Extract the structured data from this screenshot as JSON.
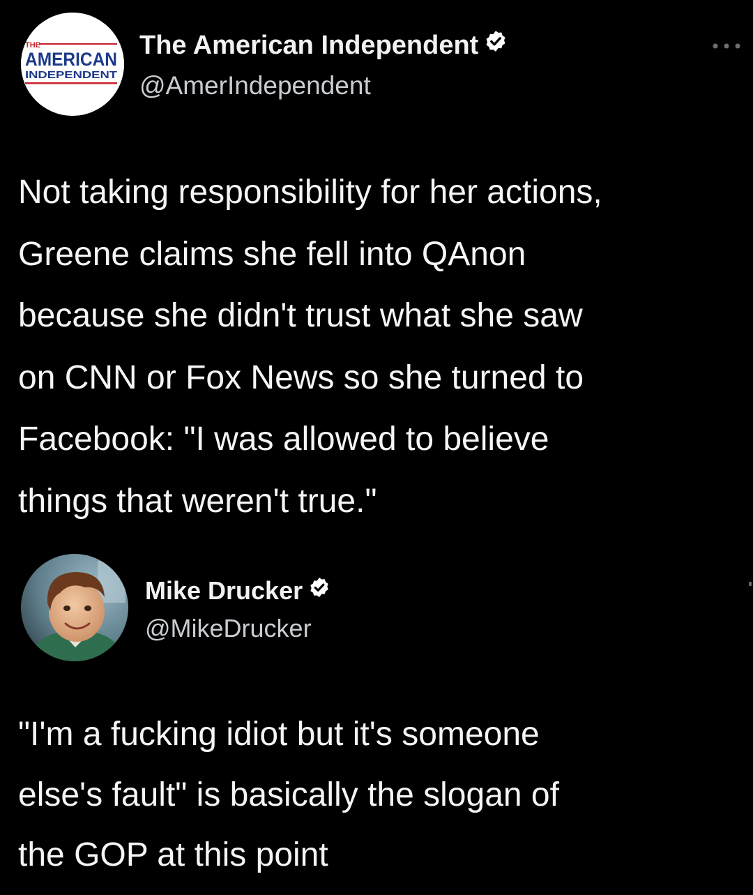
{
  "tweet_original": {
    "display_name": "The American Independent",
    "handle": "@AmerIndependent",
    "verified": true,
    "logo_text": "THE AMERICAN INDEPENDENT",
    "text": "Not taking responsibility for her actions,\nGreene claims she fell into QAnon\nbecause she didn't trust what she saw\non CNN or Fox News so she turned to\nFacebook: \"I was allowed to believe\nthings that weren't true.\""
  },
  "tweet_reply": {
    "display_name": "Mike Drucker",
    "handle": "@MikeDrucker",
    "verified": true,
    "text": "\"I'm a fucking idiot but it's someone\nelse's fault\" is basically the slogan of\nthe GOP at this point"
  },
  "icons": {
    "verified": "verified-badge-icon",
    "more": "more-options-icon"
  },
  "colors": {
    "background": "#000000",
    "text": "#f5f5f5",
    "logo_blue": "#1d3a8a",
    "logo_red": "#c8202b"
  }
}
